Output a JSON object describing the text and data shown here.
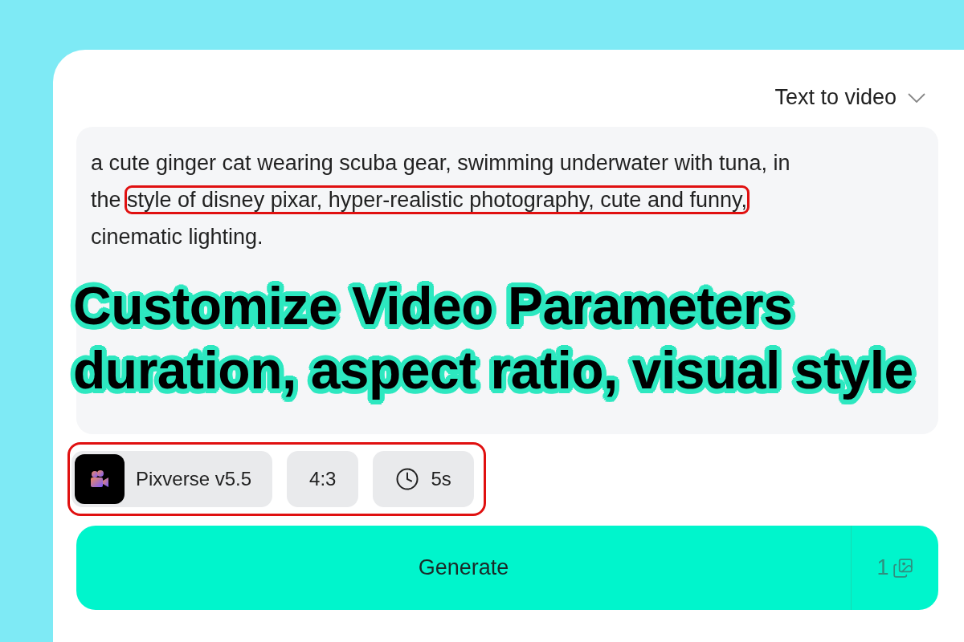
{
  "mode_select": {
    "label": "Text to video"
  },
  "prompt": {
    "segments": [
      {
        "text": "a cute ginger cat wearing scuba gear, swimming underwater with tuna, in the ",
        "highlighted": false
      },
      {
        "text": "style of disney pixar, hyper-realistic photography, cute and funny,",
        "highlighted": true
      },
      {
        "text": " cinematic lighting.",
        "highlighted": false
      }
    ]
  },
  "headline": [
    "Customize Video Parameters",
    "duration, aspect ratio, visual style"
  ],
  "options": {
    "highlighted": true,
    "items": [
      {
        "kind": "model",
        "label": "Pixverse v5.5"
      },
      {
        "kind": "plain",
        "label": "4:3"
      },
      {
        "kind": "duration",
        "label": "5s"
      }
    ]
  },
  "generate": {
    "label": "Generate",
    "count": "1"
  }
}
